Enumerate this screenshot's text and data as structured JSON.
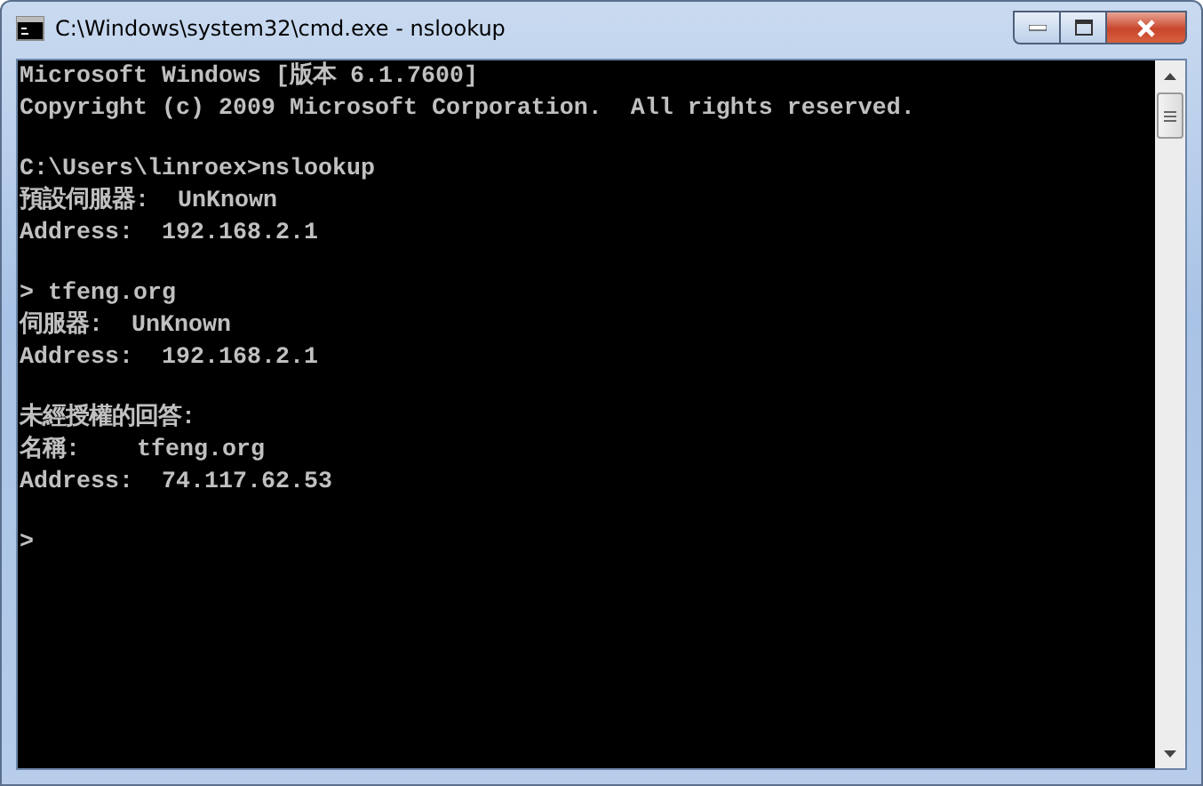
{
  "window": {
    "title": "C:\\Windows\\system32\\cmd.exe - nslookup"
  },
  "console": {
    "blocks": [
      [
        "Microsoft Windows [版本 6.1.7600]",
        "Copyright (c) 2009 Microsoft Corporation.  All rights reserved."
      ],
      [
        "C:\\Users\\linroex>nslookup",
        "預設伺服器:  UnKnown",
        "Address:  192.168.2.1"
      ],
      [
        "> tfeng.org",
        "伺服器:  UnKnown",
        "Address:  192.168.2.1"
      ],
      [
        "未經授權的回答:",
        "名稱:    tfeng.org",
        "Address:  74.117.62.53"
      ],
      [
        ">"
      ]
    ]
  }
}
